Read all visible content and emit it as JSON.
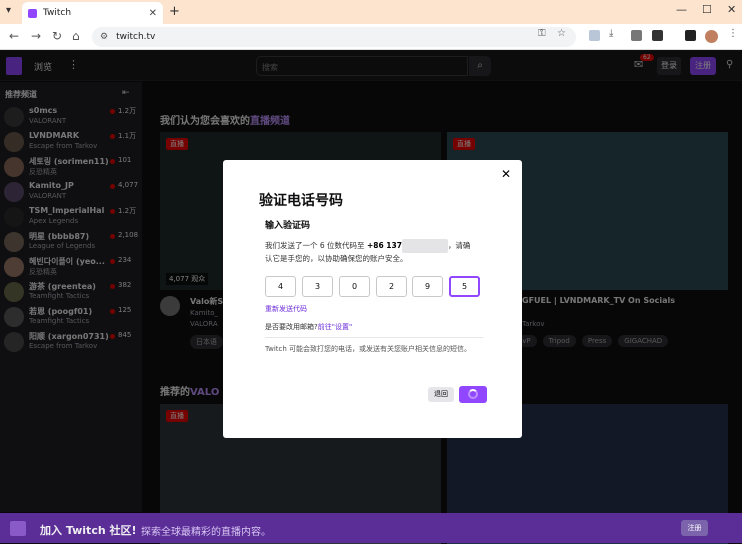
{
  "browser": {
    "tab_title": "Twitch",
    "tab_close": "✕",
    "new_tab": "+",
    "url": "twitch.tv",
    "minimize": "—",
    "maximize": "☐",
    "close": "✕"
  },
  "twitch": {
    "nav": {
      "browse": "浏览",
      "more": "⋮",
      "search_placeholder": "搜索",
      "notification_count": "62",
      "login": "登录",
      "signup": "注册"
    },
    "sidebar": {
      "heading": "推荐频道",
      "channels": [
        {
          "name": "s0mcs",
          "game": "VALORANT",
          "viewers": "1.2万"
        },
        {
          "name": "LVNDMARK",
          "game": "Escape from Tarkov",
          "viewers": "1.1万"
        },
        {
          "name": "세토링 (sorimen11)",
          "game": "反恐精英",
          "viewers": "101"
        },
        {
          "name": "Kamito_JP",
          "game": "VALORANT",
          "viewers": "4,077"
        },
        {
          "name": "TSM_ImperialHal",
          "game": "Apex Legends",
          "viewers": "1.2万"
        },
        {
          "name": "明星 (bbbb87)",
          "game": "League of Legends",
          "viewers": "2,108"
        },
        {
          "name": "혜빈다이플이 (yeo...",
          "game": "反恐精英",
          "viewers": "234"
        },
        {
          "name": "游茶 (greentea)",
          "game": "Teamfight Tactics",
          "viewers": "382"
        },
        {
          "name": "若恩 (poogf01)",
          "game": "Teamfight Tactics",
          "viewers": "125"
        },
        {
          "name": "阳顺 (xargon0731)",
          "game": "Escape from Tarkov",
          "viewers": "845"
        }
      ]
    },
    "main": {
      "section1_prefix": "我们认为您会喜欢的",
      "section1_highlight": "直播频道",
      "live_label": "直播",
      "card1_viewers": "4,077 观众",
      "card1_title": "Valo新S",
      "card1_channel": "Kamito_",
      "card1_game": "VALORA",
      "card1_tag": "日本语",
      "card2_title": "GFUEL | LVNDMARK_TV On Socials",
      "card2_game": "Tarkov",
      "card2_tags": [
        "PvP",
        "Tripod",
        "Press",
        "GIGACHAD"
      ],
      "section2_prefix": "推荐的",
      "section2_highlight": "VALO"
    },
    "banner": {
      "title": "加入 Twitch 社区!",
      "subtitle": "探索全球最精彩的直播内容。",
      "button": "注册"
    }
  },
  "modal": {
    "close": "✕",
    "title": "验证电话号码",
    "subtitle": "输入验证码",
    "desc_before": "我们发送了一个 6 位数代码至 ",
    "phone": "+86 137",
    "desc_after": "，请确认它是手您的，以协助确保您的账户安全。",
    "code_digits": [
      "4",
      "3",
      "0",
      "2",
      "9",
      "5"
    ],
    "resend": "重新发送代码",
    "email_question": "是否要改用邮箱?",
    "email_link": "前往\"设置\"",
    "note": "Twitch 可能会致打您的电话，或发送有关您账户相关信息的短信。",
    "back_button": "退回"
  }
}
